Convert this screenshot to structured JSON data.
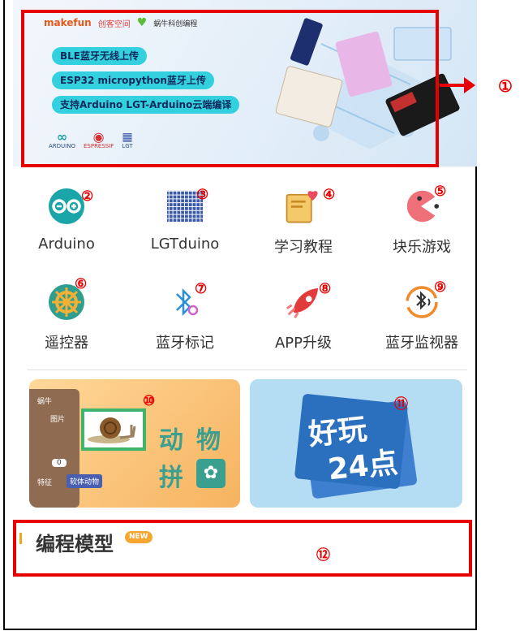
{
  "banner": {
    "logos": [
      "makefun",
      "创客空间",
      "蜗牛科创编程"
    ],
    "pills": [
      "BLE蓝牙无线上传",
      "ESP32 micropython蓝牙上传",
      "支持Arduino LGT-Arduino云端编译"
    ],
    "bottom_logos": [
      "ARDUINO",
      "ESPRESSIF",
      "LGT"
    ]
  },
  "grid": {
    "row1": [
      {
        "label": "Arduino",
        "icon": "arduino-icon"
      },
      {
        "label": "LGTduino",
        "icon": "lgt-chip-icon"
      },
      {
        "label": "学习教程",
        "icon": "book-heart-icon"
      },
      {
        "label": "块乐游戏",
        "icon": "pacman-game-icon"
      }
    ],
    "row2": [
      {
        "label": "遥控器",
        "icon": "ship-wheel-icon"
      },
      {
        "label": "蓝牙标记",
        "icon": "bluetooth-gear-icon"
      },
      {
        "label": "APP升级",
        "icon": "rocket-icon"
      },
      {
        "label": "蓝牙监视器",
        "icon": "bluetooth-monitor-icon"
      }
    ]
  },
  "cards": {
    "animal": {
      "side_labels": [
        "蜗牛",
        "图片",
        "0",
        "特征"
      ],
      "tag": "软体动物",
      "title": "动物拼图",
      "title_chars": [
        "动",
        "物",
        "拼"
      ]
    },
    "game24": {
      "title_line1": "好玩",
      "title_line2": "24点"
    }
  },
  "section": {
    "title": "编程模型",
    "badge": "NEW"
  },
  "markers": [
    "①",
    "②",
    "③",
    "④",
    "⑤",
    "⑥",
    "⑦",
    "⑧",
    "⑨",
    "⑩",
    "⑪",
    "⑫"
  ],
  "colors": {
    "callout": "#e60000",
    "pill": "#33d0e0",
    "card_orange": "#f6b35f",
    "card_blue": "#b4dcf2",
    "badge": "#f7a531"
  }
}
